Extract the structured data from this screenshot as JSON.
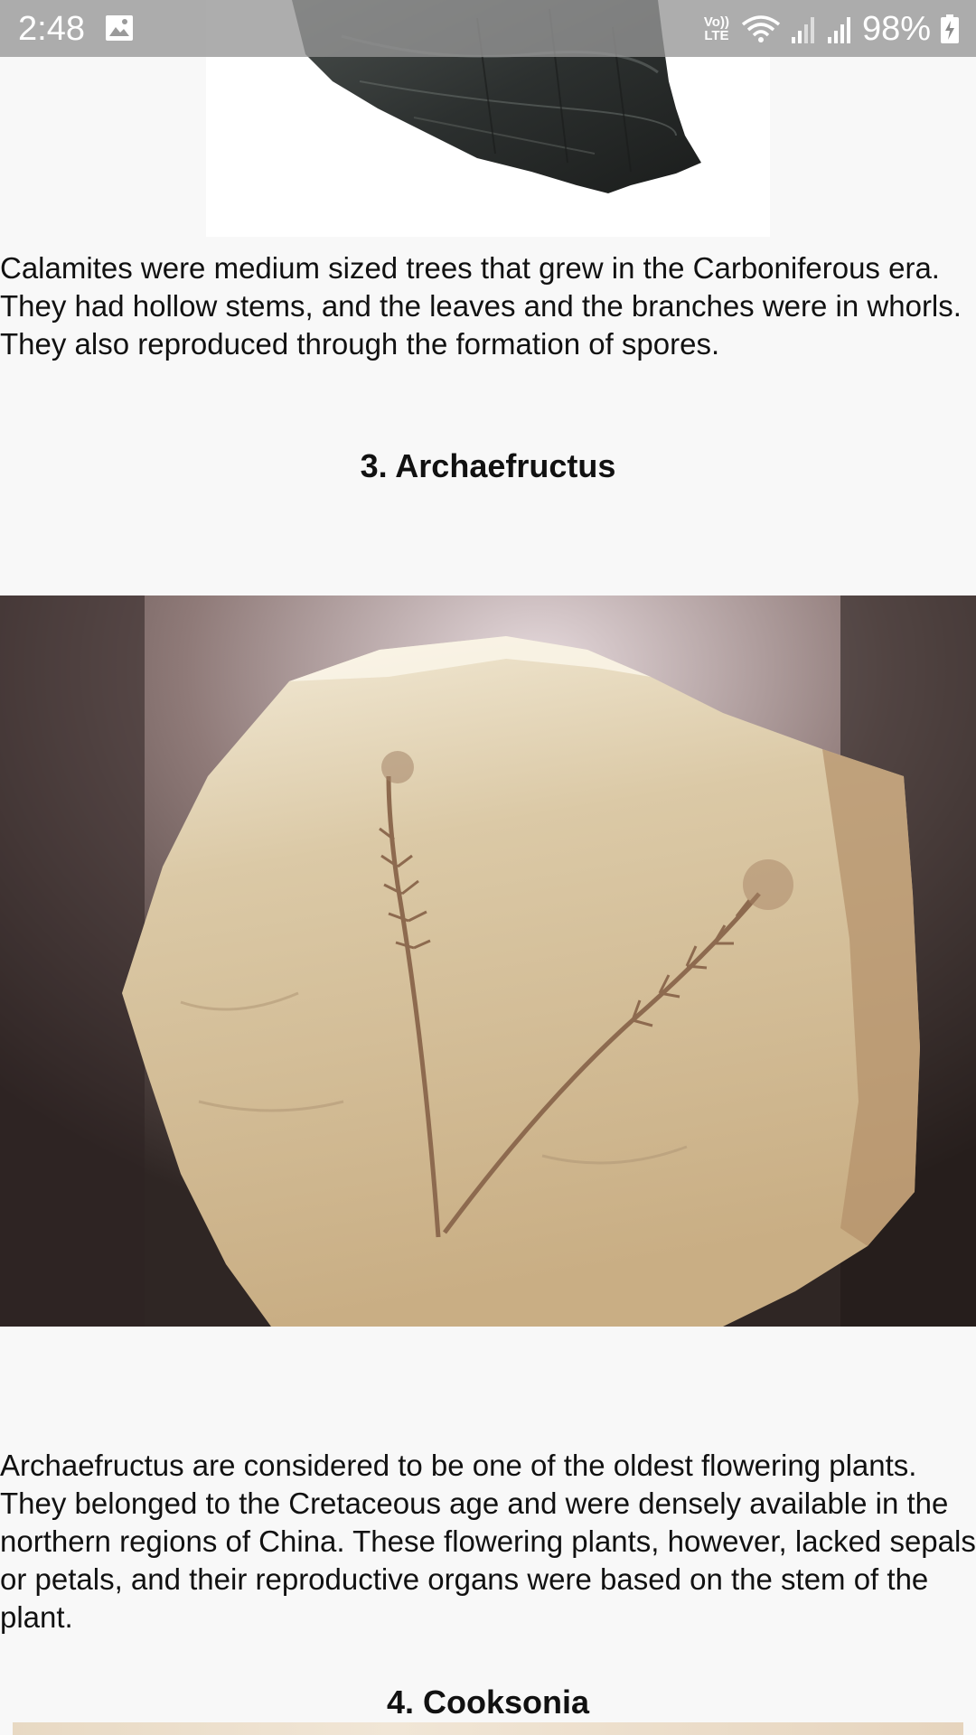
{
  "status_bar": {
    "time": "2:48",
    "volte_label": "Vo)) LTE",
    "battery_percent": "98%",
    "icons": [
      "gallery-icon",
      "wifi-icon",
      "signal-icon",
      "signal-icon",
      "battery-charging-icon"
    ]
  },
  "article": {
    "image_1": {
      "subject": "calamites fossil"
    },
    "paragraph_1": "Calamites were medium sized trees that grew in the Carboniferous era. They had hollow stems, and the leaves and the branches were in whorls. They also reproduced through the formation of spores.",
    "heading_3": "3. Archaefructus",
    "image_2": {
      "subject": "archaefructus fossil"
    },
    "paragraph_2": "Archaefructus are considered to be one of the oldest flowering plants. They belonged to the  Cretaceous age and were densely available in the northern regions of China. These flowering plants, however, lacked sepals or petals, and their reproductive organs were based on the stem of the plant.",
    "heading_4": "4. Cooksonia",
    "image_3": {
      "subject": "cooksonia fossil"
    }
  }
}
